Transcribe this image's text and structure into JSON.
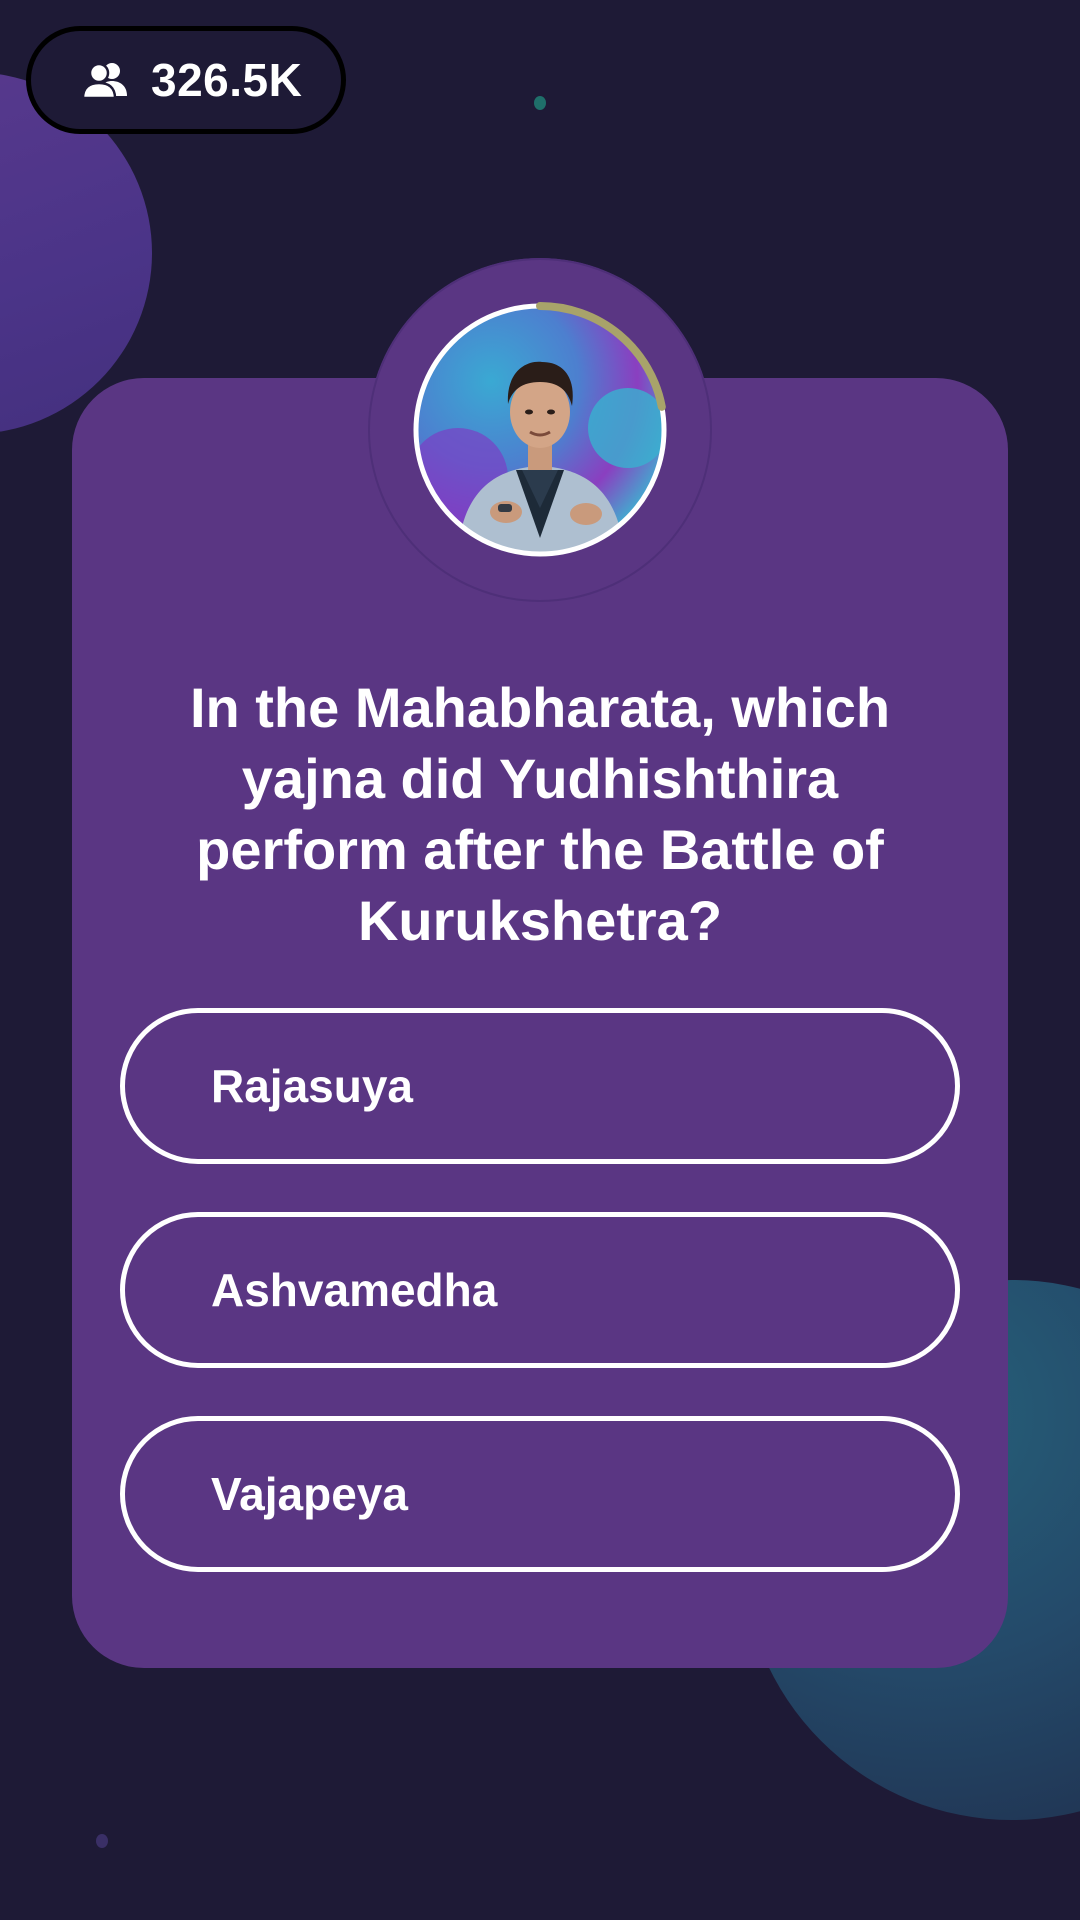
{
  "header": {
    "viewer_icon": "users-icon",
    "viewer_count": "326.5K"
  },
  "host": {
    "avatar_icon": "host-avatar",
    "timer_progress": 0.22,
    "timer_color": "#a8a36a"
  },
  "quiz": {
    "question": "In the Mahabharata, which yajna did Yudhishthira perform after the Battle of Kurukshetra?",
    "options": [
      {
        "label": "Rajasuya"
      },
      {
        "label": "Ashvamedha"
      },
      {
        "label": "Vajapeya"
      }
    ]
  },
  "colors": {
    "background": "#1e1a36",
    "card": "#5a3683",
    "option_border": "#ffffff",
    "text": "#ffffff"
  }
}
